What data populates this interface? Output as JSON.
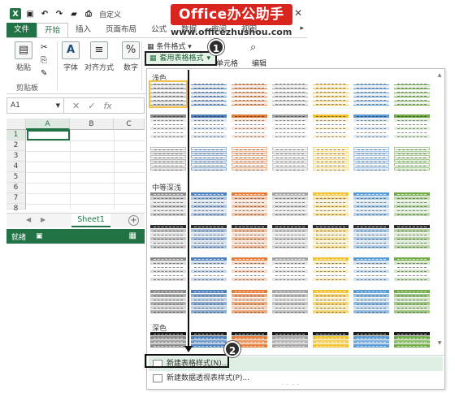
{
  "title_bar": {
    "doc_title": "自定义",
    "help_symbol": "?",
    "close_symbol": "✕"
  },
  "brand": {
    "name": "Office办公助手",
    "url": "www.officezhushou.com"
  },
  "ribbon_tabs": [
    {
      "label": "文件"
    },
    {
      "label": "开始"
    },
    {
      "label": "插入"
    },
    {
      "label": "页面布局"
    },
    {
      "label": "公式"
    },
    {
      "label": "数据"
    },
    {
      "label": "审阅"
    },
    {
      "label": "视图"
    }
  ],
  "ribbon": {
    "paste_label": "粘贴",
    "clipboard_label": "剪贴板",
    "font_label": "字体",
    "align_label": "对齐方式",
    "number_label": "数字",
    "conditional_format_label": "条件格式",
    "table_format_label": "套用表格格式",
    "cell_label": "单元格",
    "edit_label": "编辑"
  },
  "formula_bar": {
    "name_box": "A1",
    "fx": "fx",
    "cancel": "✕",
    "confirm": "✓"
  },
  "sheet": {
    "columns": [
      "A",
      "B",
      "C"
    ],
    "rows": [
      "1",
      "2",
      "3",
      "4",
      "5",
      "6",
      "7",
      "8"
    ],
    "tab_name": "Sheet1",
    "add_symbol": "+"
  },
  "status_bar": {
    "ready": "就绪"
  },
  "gallery": {
    "section_light": "浅色",
    "section_medium": "中等深浅",
    "section_dark": "深色",
    "accent_colors": [
      "#8a8a8a",
      "#4f81bd",
      "#e57d3a",
      "#a5a5a5",
      "#f1c232",
      "#5b9bd5",
      "#70ad47"
    ],
    "new_table_style": "新建表格样式(N)...",
    "new_pivot_style": "新建数据透视表样式(P)..."
  },
  "callouts": {
    "one": "1",
    "two": "2"
  }
}
